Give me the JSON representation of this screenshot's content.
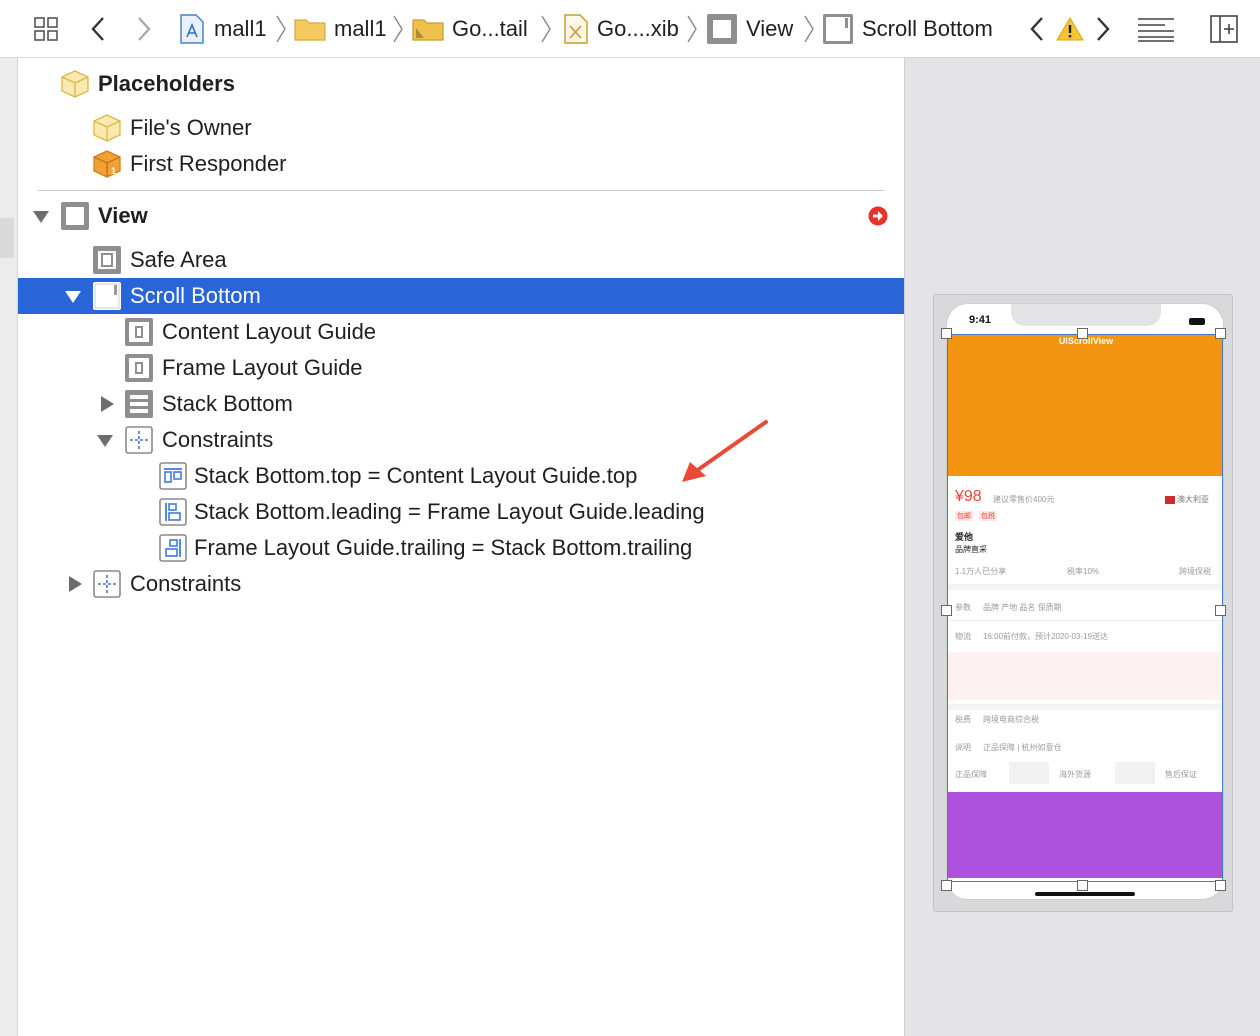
{
  "jumpbar": {
    "crumbs": [
      {
        "label": "mall1",
        "icon": "project-file-icon"
      },
      {
        "label": "mall1",
        "icon": "folder-icon"
      },
      {
        "label": "Go...tail",
        "icon": "folder-icon"
      },
      {
        "label": "Go....xib",
        "icon": "xib-file-icon"
      },
      {
        "label": "View",
        "icon": "view-icon"
      },
      {
        "label": "Scroll Bottom",
        "icon": "scroll-view-icon"
      }
    ]
  },
  "outline": {
    "placeholders_label": "Placeholders",
    "files_owner_label": "File's Owner",
    "first_responder_label": "First Responder",
    "view_label": "View",
    "safe_area_label": "Safe Area",
    "scroll_bottom_label": "Scroll Bottom",
    "content_layout_guide_label": "Content Layout Guide",
    "frame_layout_guide_label": "Frame Layout Guide",
    "stack_bottom_label": "Stack Bottom",
    "inner_constraints_label": "Constraints",
    "constraint_top": "Stack Bottom.top = Content Layout Guide.top",
    "constraint_leading": "Stack Bottom.leading = Frame Layout Guide.leading",
    "constraint_trailing": "Frame Layout Guide.trailing = Stack Bottom.trailing",
    "outer_constraints_label": "Constraints"
  },
  "preview": {
    "status_time": "9:41",
    "scroll_view_title": "UIScrollView",
    "price": "¥98",
    "suggested_price": "建议零售价400元",
    "origin_flag": "澳大利亚",
    "tag_1": "包邮",
    "tag_2": "包税",
    "product_name": "爱他",
    "product_brand": "品牌直采",
    "shared_count": "1.1万人已分享",
    "tax_rate": "税率10%",
    "bonded": "跨境保税",
    "params_label": "参数",
    "params_value": "品牌 产地 品名 保质期",
    "logistics_label": "物流",
    "logistics_value": "16:00前付款，预计2020-03-19送达",
    "tax_label": "税费",
    "tax_value": "跨境电商综合税",
    "note_label": "说明",
    "note_value": "正品保障 | 杭州如意仓",
    "badge_1": "正品保障",
    "badge_2": "海外货源",
    "badge_3": "售后保证"
  },
  "colors": {
    "selection": "#2965d9",
    "orange_view": "#f39510",
    "purple_view": "#ad52de",
    "error_badge": "#e8312b",
    "annotation_arrow": "#ea4a35"
  }
}
